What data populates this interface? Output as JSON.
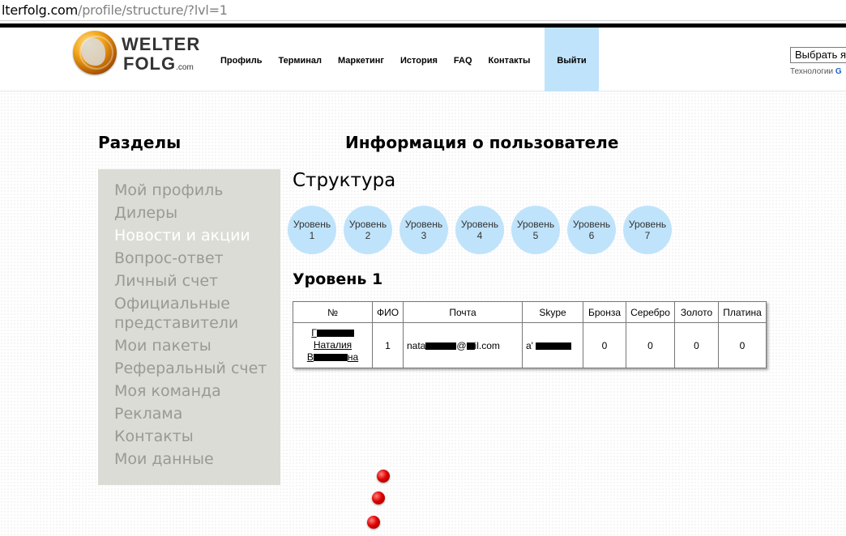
{
  "browser": {
    "url_host": "lterfolg.com",
    "url_path": "/profile/structure/?lvl=1"
  },
  "logo": {
    "line1": "WELTER",
    "line2": "FOLG",
    "domain": ".com"
  },
  "nav": [
    {
      "label": "Профиль"
    },
    {
      "label": "Терминал"
    },
    {
      "label": "Маркетинг"
    },
    {
      "label": "История"
    },
    {
      "label": "FAQ"
    },
    {
      "label": "Контакты"
    },
    {
      "label": "Выйти"
    }
  ],
  "translate": {
    "select_label": "Выбрать яз",
    "tech_label": "Технологии ",
    "tech_brand": "G"
  },
  "sidebar": {
    "title": "Разделы",
    "items": [
      {
        "label": "Мой профиль"
      },
      {
        "label": "Дилеры"
      },
      {
        "label": "Новости и акции"
      },
      {
        "label": "Вопрос-ответ"
      },
      {
        "label": "Личный счет"
      },
      {
        "label": "Официальные представители"
      },
      {
        "label": "Мои пакеты"
      },
      {
        "label": "Реферальный счет"
      },
      {
        "label": "Моя команда"
      },
      {
        "label": "Реклама"
      },
      {
        "label": "Контакты"
      },
      {
        "label": "Мои данные"
      }
    ],
    "active_index": 2
  },
  "content": {
    "info_title": "Информация о пользователе",
    "structure_title": "Структура",
    "levels": [
      {
        "word": "Уровень",
        "num": "1"
      },
      {
        "word": "Уровень",
        "num": "2"
      },
      {
        "word": "Уровень",
        "num": "3"
      },
      {
        "word": "Уровень",
        "num": "4"
      },
      {
        "word": "Уровень",
        "num": "5"
      },
      {
        "word": "Уровень",
        "num": "6"
      },
      {
        "word": "Уровень",
        "num": "7"
      }
    ],
    "level_title": "Уровень 1"
  },
  "table": {
    "headers": [
      "№",
      "ФИО",
      "Почта",
      "Skype",
      "Бронза",
      "Серебро",
      "Золото",
      "Платина"
    ],
    "rows": [
      {
        "name_line1": "Г",
        "name_line2": "Наталия",
        "name_line3": "В",
        "name_line3_end": "на",
        "fio": "1",
        "email_start": "nata",
        "email_mid": "@",
        "email_end": "il.com",
        "skype_start": "a'",
        "bronze": "0",
        "silver": "0",
        "gold": "0",
        "platinum": "0"
      }
    ]
  }
}
